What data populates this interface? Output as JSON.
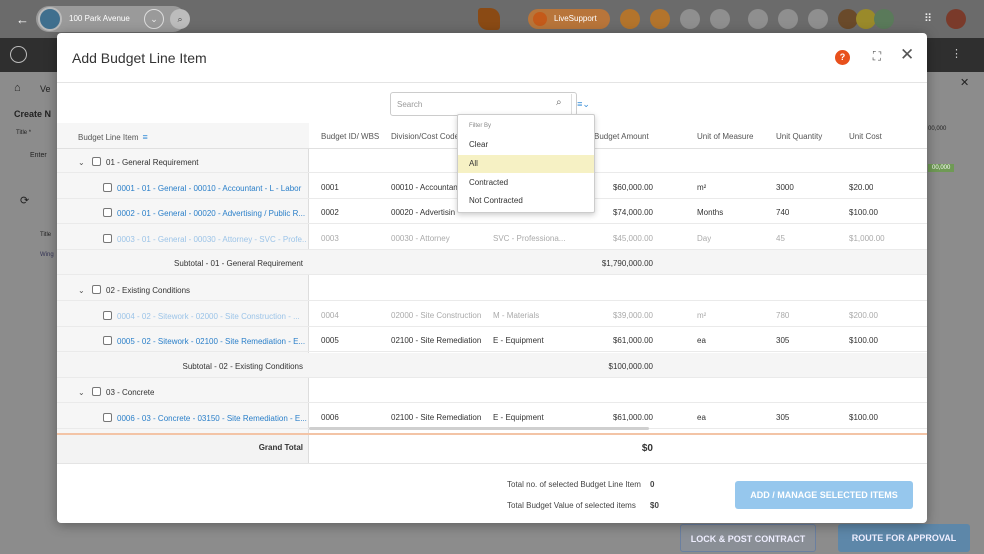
{
  "topbar": {
    "project": "100 Park Avenue",
    "live_support": "LiveSupport"
  },
  "background": {
    "create_label": "Create N",
    "title_label": "Title *",
    "enter_label": "Enter",
    "ve_label": "Ve",
    "amount_1": "00,000",
    "amount_2": "00,000",
    "col_title": "Title",
    "row_win": "Wing",
    "lock_button": "LOCK & POST CONTRACT",
    "route_button": "ROUTE FOR APPROVAL"
  },
  "modal": {
    "title": "Add Budget Line Item",
    "search_placeholder": "Search",
    "columns": {
      "line_item": "Budget Line Item",
      "budget_id": "Budget ID/ WBS",
      "division": "Division/Cost Code",
      "amount": "Budget Amount",
      "uom": "Unit of Measure",
      "qty": "Unit Quantity",
      "cost": "Unit Cost"
    },
    "rows": [
      {
        "kind": "group",
        "label": "01 - General Requirement"
      },
      {
        "kind": "item",
        "dim": false,
        "label": "0001 - 01 - General - 00010 - Accountant - L - Labor",
        "id": "0001",
        "division": "00010 - Accountant",
        "type": "",
        "amount": "$60,000.00",
        "uom": "m²",
        "qty": "3000",
        "cost": "$20.00"
      },
      {
        "kind": "item",
        "dim": false,
        "label": "0002 - 01 - General - 00020 - Advertising / Public R...",
        "id": "0002",
        "division": "00020 - Advertisin",
        "type": "",
        "amount": "$74,000.00",
        "uom": "Months",
        "qty": "740",
        "cost": "$100.00"
      },
      {
        "kind": "item",
        "dim": true,
        "label": "0003 - 01 - General - 00030 - Attorney - SVC - Profe...",
        "id": "0003",
        "division": "00030 - Attorney",
        "type": "SVC - Professiona...",
        "amount": "$45,000.00",
        "uom": "Day",
        "qty": "45",
        "cost": "$1,000.00"
      },
      {
        "kind": "subtotal",
        "label": "Subtotal - 01 - General Requirement",
        "amount": "$1,790,000.00"
      },
      {
        "kind": "group",
        "label": "02 - Existing Conditions"
      },
      {
        "kind": "item",
        "dim": true,
        "label": "0004 - 02 - Sitework - 02000 - Site Construction - ...",
        "id": "0004",
        "division": "02000 - Site Construction",
        "type": "M - Materials",
        "amount": "$39,000.00",
        "uom": "m²",
        "qty": "780",
        "cost": "$200.00"
      },
      {
        "kind": "item",
        "dim": false,
        "label": "0005 - 02 - Sitework - 02100 - Site Remediation - E...",
        "id": "0005",
        "division": "02100 - Site Remediation",
        "type": "E - Equipment",
        "amount": "$61,000.00",
        "uom": "ea",
        "qty": "305",
        "cost": "$100.00"
      },
      {
        "kind": "subtotal",
        "label": "Subtotal - 02 - Existing Conditions",
        "amount": "$100,000.00"
      },
      {
        "kind": "group",
        "label": "03 - Concrete"
      },
      {
        "kind": "item",
        "dim": false,
        "label": "0006 - 03 - Concrete - 03150 - Site Remediation - E...",
        "id": "0006",
        "division": "02100 - Site Remediation",
        "type": "E - Equipment",
        "amount": "$61,000.00",
        "uom": "ea",
        "qty": "305",
        "cost": "$100.00"
      }
    ],
    "grand_total_label": "Grand Total",
    "grand_total_value": "$0",
    "footer": {
      "count_label": "Total no. of selected Budget Line Item",
      "count_value": "0",
      "value_label": "Total Budget Value of selected items",
      "value_value": "$0",
      "add_button": "ADD / MANAGE SELECTED ITEMS"
    },
    "filter_dropdown": {
      "heading": "Filter By",
      "options": [
        "Clear",
        "All",
        "Contracted",
        "Not Contracted"
      ],
      "selected": "All"
    }
  },
  "colors": {
    "accent": "#2a7fc9",
    "help": "#e8501c",
    "selected_option": "#f6f1c4",
    "add_button": "#96c7ed"
  }
}
